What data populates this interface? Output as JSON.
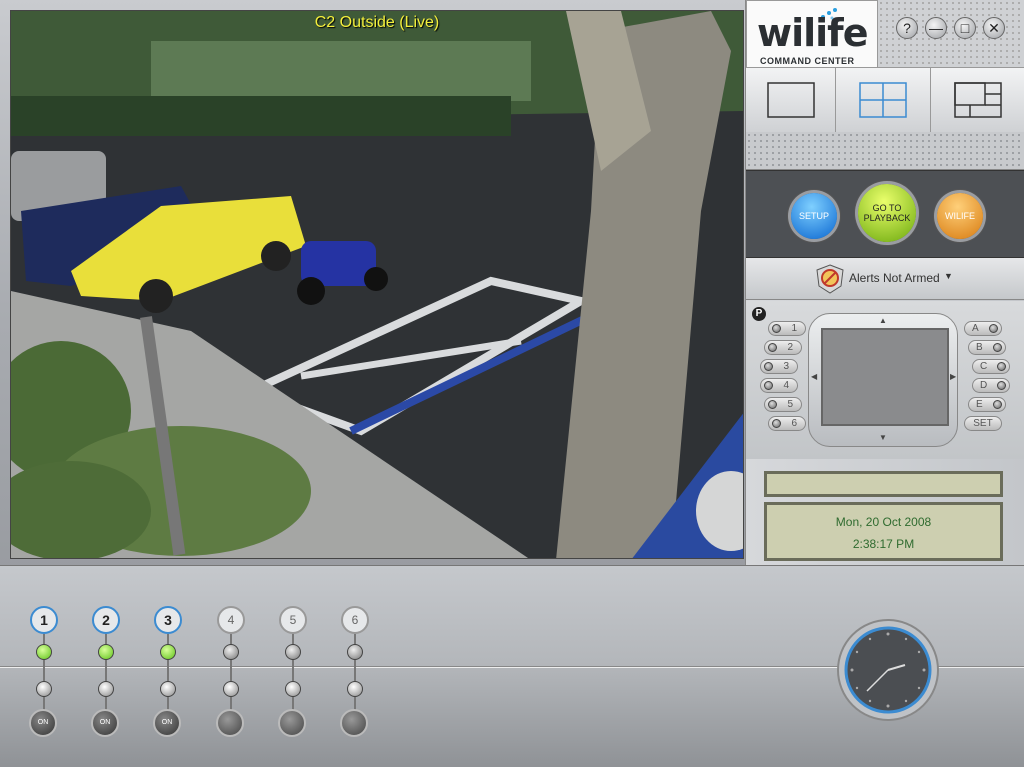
{
  "camera": {
    "title": "C2 Outside (Live)"
  },
  "logo": {
    "brand": "wilife",
    "subtitle": "COMMAND CENTER"
  },
  "window_buttons": {
    "help": "?",
    "minimize": "—",
    "maximize": "□",
    "close": "✕"
  },
  "actions": {
    "setup": "SETUP",
    "playback": "GO TO PLAYBACK",
    "wilife": "WILIFE"
  },
  "alerts": {
    "label": "Alerts Not Armed"
  },
  "ptz": {
    "presets_left": [
      "1",
      "2",
      "3",
      "4",
      "5",
      "6"
    ],
    "presets_right": [
      "A",
      "B",
      "C",
      "D",
      "E"
    ],
    "set_label": "SET",
    "badge": "P"
  },
  "status": {
    "date": "Mon, 20 Oct 2008",
    "time": "2:38:17 PM"
  },
  "channels": [
    {
      "num": "1",
      "active": true,
      "on_label": "ON"
    },
    {
      "num": "2",
      "active": true,
      "on_label": "ON"
    },
    {
      "num": "3",
      "active": true,
      "on_label": "ON"
    },
    {
      "num": "4",
      "active": false,
      "on_label": ""
    },
    {
      "num": "5",
      "active": false,
      "on_label": ""
    },
    {
      "num": "6",
      "active": false,
      "on_label": ""
    }
  ],
  "colors": {
    "accent_blue": "#3b8bd1",
    "live_title": "#f3ef3c",
    "led_green": "#5fc21a",
    "date_text": "#2f6b2f"
  }
}
